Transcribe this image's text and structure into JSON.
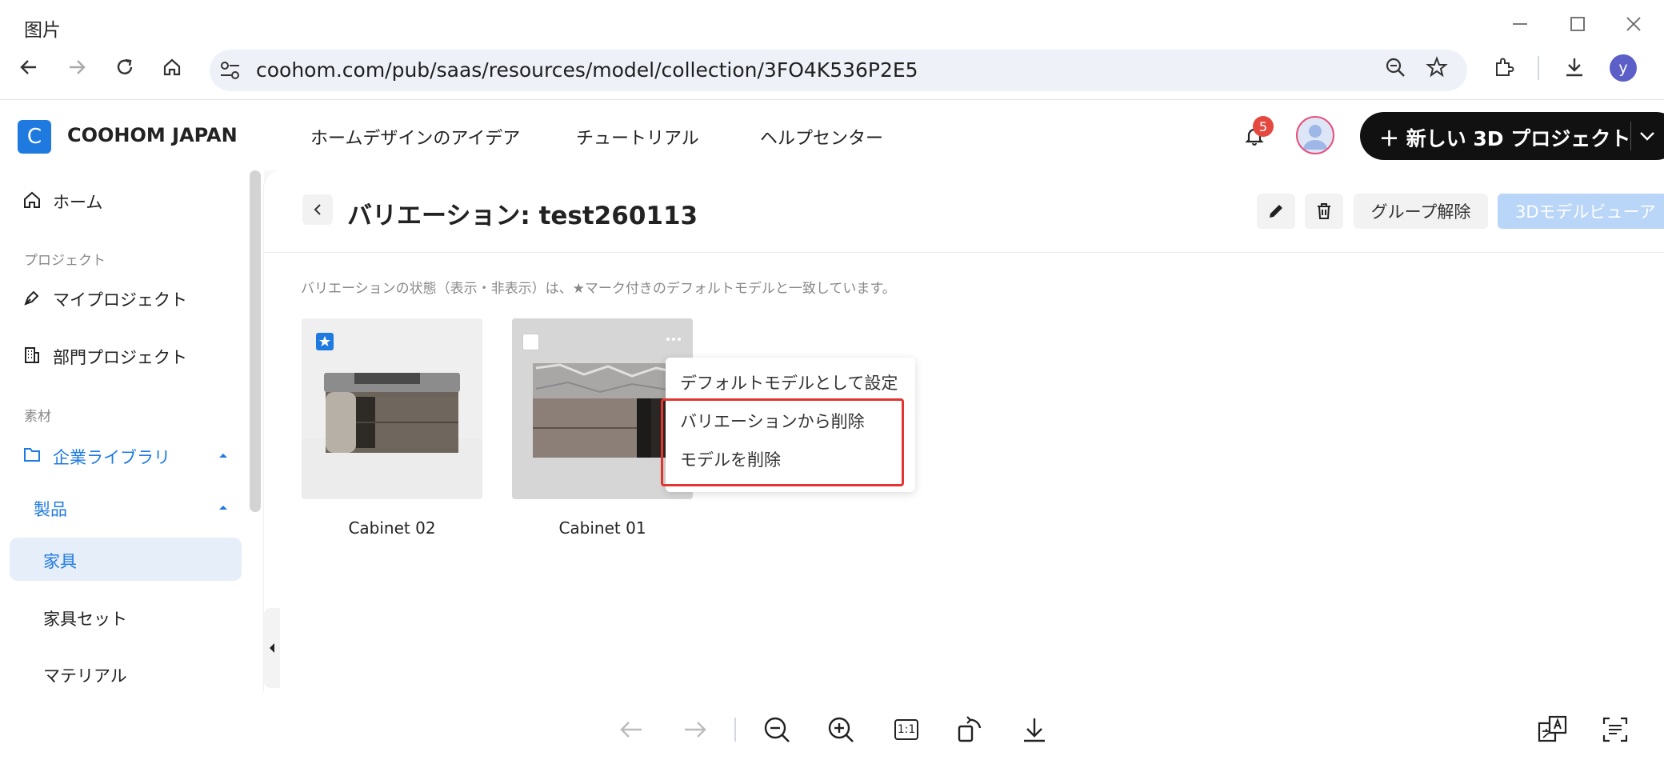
{
  "window": {
    "title": "图片"
  },
  "browser": {
    "url": "coohom.com/pub/saas/resources/model/collection/3FO4K536P2E5",
    "profile_initial": "y"
  },
  "header": {
    "logo_letter": "C",
    "brand": "COOHOM JAPAN",
    "nav": [
      "ホームデザインのアイデア",
      "チュートリアル",
      "ヘルプセンター"
    ],
    "notification_count": "5",
    "new_project_label": "＋ 新しい 3D プロジェクト"
  },
  "sidebar": {
    "home": "ホーム",
    "section_project": "プロジェクト",
    "my_project": "マイプロジェクト",
    "dept_project": "部門プロジェクト",
    "section_material": "素材",
    "enterprise_library": "企業ライブラリ",
    "products": "製品",
    "furniture": "家具",
    "furniture_set": "家具セット",
    "material": "マテリアル"
  },
  "main": {
    "title": "バリエーション: test260113",
    "ungroup_label": "グループ解除",
    "viewer_label": "3Dモデルビューア",
    "notice": "バリエーションの状態（表示・非表示）は、★マーク付きのデフォルトモデルと一致しています。",
    "cards": [
      {
        "name": "Cabinet 02",
        "default": true
      },
      {
        "name": "Cabinet 01",
        "default": false
      }
    ],
    "context_menu": [
      "デフォルトモデルとして設定",
      "バリエーションから削除",
      "モデルを削除"
    ]
  },
  "viewer_bar": {
    "ratio_label": "1:1"
  },
  "colors": {
    "accent": "#1f7ae0",
    "highlight": "#e3342f",
    "badge": "#e5483f",
    "cta": "#111111"
  }
}
